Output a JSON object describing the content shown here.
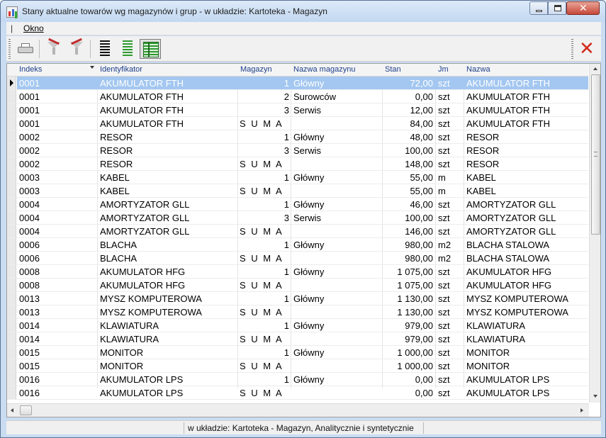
{
  "window": {
    "title": "Stany aktualne towarów wg magazynów i grup - w układzie: Kartoteka - Magazyn"
  },
  "menu": {
    "items": [
      {
        "label": "Okno"
      }
    ]
  },
  "toolbar": {
    "buttons": [
      "printer-icon",
      "filter-icon",
      "filter-clear-icon",
      "list-black-icon",
      "list-green-icon",
      "grid-green-icon",
      "close-icon"
    ]
  },
  "table": {
    "columns": [
      "Indeks",
      "Identyfikator",
      "Magazyn",
      "Nazwa magazynu",
      "Stan",
      "Jm",
      "Nazwa"
    ],
    "rows": [
      {
        "indeks": "0001",
        "identyfikator": "AKUMULATOR FTH",
        "magazyn": "1",
        "nazwa_magazynu": "Główny",
        "stan": "72,00",
        "jm": "szt",
        "nazwa": "AKUMULATOR FTH"
      },
      {
        "indeks": "0001",
        "identyfikator": "AKUMULATOR FTH",
        "magazyn": "2",
        "nazwa_magazynu": "Surowców",
        "stan": "0,00",
        "jm": "szt",
        "nazwa": "AKUMULATOR FTH"
      },
      {
        "indeks": "0001",
        "identyfikator": "AKUMULATOR FTH",
        "magazyn": "3",
        "nazwa_magazynu": "Serwis",
        "stan": "12,00",
        "jm": "szt",
        "nazwa": "AKUMULATOR FTH"
      },
      {
        "indeks": "0001",
        "identyfikator": "AKUMULATOR FTH",
        "magazyn": "S U M A",
        "nazwa_magazynu": "",
        "stan": "84,00",
        "jm": "szt",
        "nazwa": "AKUMULATOR FTH"
      },
      {
        "indeks": "0002",
        "identyfikator": "RESOR",
        "magazyn": "1",
        "nazwa_magazynu": "Główny",
        "stan": "48,00",
        "jm": "szt",
        "nazwa": "RESOR"
      },
      {
        "indeks": "0002",
        "identyfikator": "RESOR",
        "magazyn": "3",
        "nazwa_magazynu": "Serwis",
        "stan": "100,00",
        "jm": "szt",
        "nazwa": "RESOR"
      },
      {
        "indeks": "0002",
        "identyfikator": "RESOR",
        "magazyn": "S U M A",
        "nazwa_magazynu": "",
        "stan": "148,00",
        "jm": "szt",
        "nazwa": "RESOR"
      },
      {
        "indeks": "0003",
        "identyfikator": "KABEL",
        "magazyn": "1",
        "nazwa_magazynu": "Główny",
        "stan": "55,00",
        "jm": "m",
        "nazwa": "KABEL"
      },
      {
        "indeks": "0003",
        "identyfikator": "KABEL",
        "magazyn": "S U M A",
        "nazwa_magazynu": "",
        "stan": "55,00",
        "jm": "m",
        "nazwa": "KABEL"
      },
      {
        "indeks": "0004",
        "identyfikator": "AMORTYZATOR GLL",
        "magazyn": "1",
        "nazwa_magazynu": "Główny",
        "stan": "46,00",
        "jm": "szt",
        "nazwa": "AMORTYZATOR GLL"
      },
      {
        "indeks": "0004",
        "identyfikator": "AMORTYZATOR GLL",
        "magazyn": "3",
        "nazwa_magazynu": "Serwis",
        "stan": "100,00",
        "jm": "szt",
        "nazwa": "AMORTYZATOR GLL"
      },
      {
        "indeks": "0004",
        "identyfikator": "AMORTYZATOR GLL",
        "magazyn": "S U M A",
        "nazwa_magazynu": "",
        "stan": "146,00",
        "jm": "szt",
        "nazwa": "AMORTYZATOR GLL"
      },
      {
        "indeks": "0006",
        "identyfikator": "BLACHA",
        "magazyn": "1",
        "nazwa_magazynu": "Główny",
        "stan": "980,00",
        "jm": "m2",
        "nazwa": "BLACHA STALOWA"
      },
      {
        "indeks": "0006",
        "identyfikator": "BLACHA",
        "magazyn": "S U M A",
        "nazwa_magazynu": "",
        "stan": "980,00",
        "jm": "m2",
        "nazwa": "BLACHA STALOWA"
      },
      {
        "indeks": "0008",
        "identyfikator": "AKUMULATOR HFG",
        "magazyn": "1",
        "nazwa_magazynu": "Główny",
        "stan": "1 075,00",
        "jm": "szt",
        "nazwa": "AKUMULATOR HFG"
      },
      {
        "indeks": "0008",
        "identyfikator": "AKUMULATOR HFG",
        "magazyn": "S U M A",
        "nazwa_magazynu": "",
        "stan": "1 075,00",
        "jm": "szt",
        "nazwa": "AKUMULATOR HFG"
      },
      {
        "indeks": "0013",
        "identyfikator": "MYSZ KOMPUTEROWA",
        "magazyn": "1",
        "nazwa_magazynu": "Główny",
        "stan": "1 130,00",
        "jm": "szt",
        "nazwa": "MYSZ KOMPUTEROWA"
      },
      {
        "indeks": "0013",
        "identyfikator": "MYSZ KOMPUTEROWA",
        "magazyn": "S U M A",
        "nazwa_magazynu": "",
        "stan": "1 130,00",
        "jm": "szt",
        "nazwa": "MYSZ KOMPUTEROWA"
      },
      {
        "indeks": "0014",
        "identyfikator": "KLAWIATURA",
        "magazyn": "1",
        "nazwa_magazynu": "Główny",
        "stan": "979,00",
        "jm": "szt",
        "nazwa": "KLAWIATURA"
      },
      {
        "indeks": "0014",
        "identyfikator": "KLAWIATURA",
        "magazyn": "S U M A",
        "nazwa_magazynu": "",
        "stan": "979,00",
        "jm": "szt",
        "nazwa": "KLAWIATURA"
      },
      {
        "indeks": "0015",
        "identyfikator": "MONITOR",
        "magazyn": "1",
        "nazwa_magazynu": "Główny",
        "stan": "1 000,00",
        "jm": "szt",
        "nazwa": "MONITOR"
      },
      {
        "indeks": "0015",
        "identyfikator": "MONITOR",
        "magazyn": "S U M A",
        "nazwa_magazynu": "",
        "stan": "1 000,00",
        "jm": "szt",
        "nazwa": "MONITOR"
      },
      {
        "indeks": "0016",
        "identyfikator": "AKUMULATOR LPS",
        "magazyn": "1",
        "nazwa_magazynu": "Główny",
        "stan": "0,00",
        "jm": "szt",
        "nazwa": "AKUMULATOR LPS"
      },
      {
        "indeks": "0016",
        "identyfikator": "AKUMULATOR LPS",
        "magazyn": "S U M A",
        "nazwa_magazynu": "",
        "stan": "0,00",
        "jm": "szt",
        "nazwa": "AKUMULATOR LPS"
      }
    ],
    "selected_row": 0
  },
  "status": {
    "text": "w układzie: Kartoteka - Magazyn, Analitycznie i syntetycznie"
  },
  "colors": {
    "selection": "#a3c7f0",
    "header_text": "#1d3f8a",
    "close_red": "#d42a1c",
    "toolbar_green": "#2e9a2e"
  }
}
